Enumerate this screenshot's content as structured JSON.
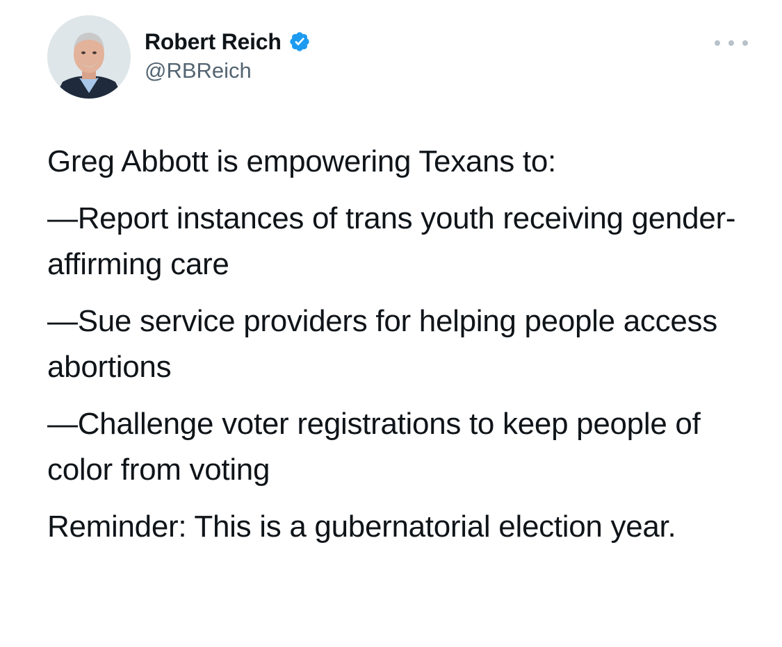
{
  "author": {
    "name": "Robert Reich",
    "handle": "@RBReich",
    "verified": true,
    "avatar_icon": "profile-photo"
  },
  "menu": {
    "icon": "more-horizontal-icon"
  },
  "tweet": {
    "paragraphs": [
      "Greg Abbott is empowering Texans to:",
      "—Report instances of trans youth receiving gender-affirming care",
      "—Sue service providers for helping people access abortions",
      "—Challenge voter registrations to keep people of color from voting",
      "Reminder: This is a gubernatorial election year."
    ]
  },
  "colors": {
    "verified_badge": "#1d9bf0",
    "text": "#0f1419",
    "secondary_text": "#536471"
  }
}
